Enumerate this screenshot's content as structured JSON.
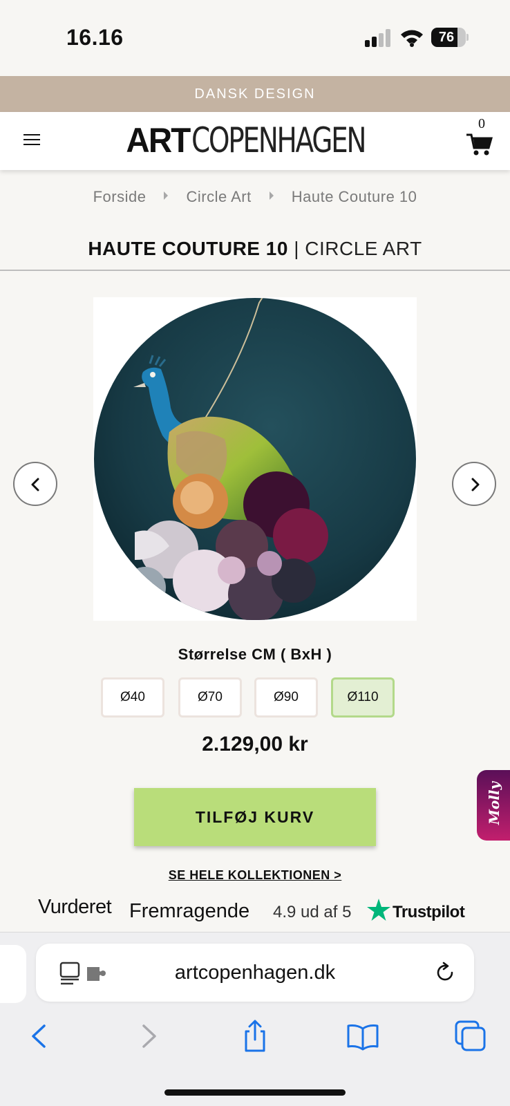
{
  "status_bar": {
    "time": "16.16",
    "battery": "76",
    "battery_level": 0.76
  },
  "announcement": {
    "text": "DANSK DESIGN"
  },
  "header": {
    "logo_bold": "ART",
    "logo_light": "COPENHAGEN",
    "cart_count": "0"
  },
  "breadcrumb": {
    "items": [
      "Forside",
      "Circle Art",
      "Haute Couture 10"
    ]
  },
  "product": {
    "title": "HAUTE COUTURE 10",
    "separator": "|",
    "collection": "CIRCLE ART",
    "size_label": "Størrelse CM ( BxH )",
    "sizes": [
      "Ø40",
      "Ø70",
      "Ø90",
      "Ø110"
    ],
    "selected_size": "Ø110",
    "price": "2.129,00 kr",
    "add_to_cart": "TILFØJ KURV",
    "collection_link": "SE HELE KOLLEKTIONEN >"
  },
  "chat_widget": {
    "label": "Molly"
  },
  "trustpilot": {
    "rated": "Vurderet",
    "rating_word": "Fremragende",
    "score": "4.9 ud af 5",
    "brand": "Trustpilot"
  },
  "browser": {
    "url": "artcopenhagen.dk"
  },
  "colors": {
    "announcement_bg": "#c4b3a2",
    "add_button_bg": "#b9dd7a",
    "selected_size_bg": "#e3efd3",
    "trustpilot_green": "#00b67a",
    "ios_blue": "#1a73e8"
  },
  "icons": [
    "hamburger-menu-icon",
    "cart-icon",
    "chevron-left-icon",
    "chevron-right-icon",
    "reader-icon",
    "extension-icon",
    "reload-icon",
    "back-icon",
    "forward-icon",
    "share-icon",
    "bookmarks-icon",
    "tabs-icon",
    "trustpilot-star-icon"
  ]
}
